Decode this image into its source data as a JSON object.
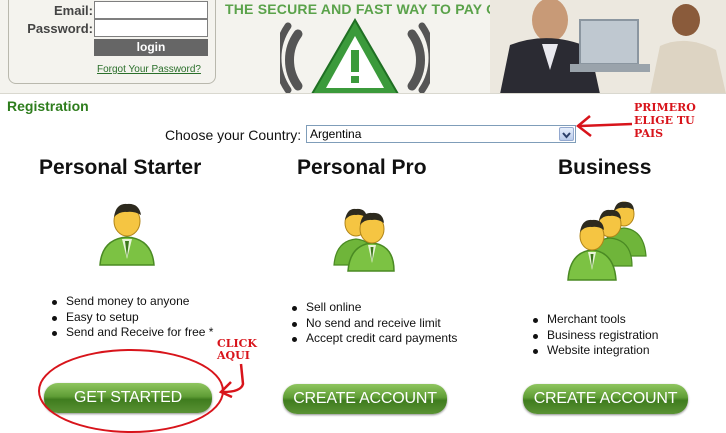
{
  "header": {
    "login": {
      "email_label": "Email:",
      "password_label": "Password:",
      "login_button": "login",
      "forgot_link": "Forgot Your Password?"
    },
    "slogan": "THE SECURE AND FAST WAY TO PAY ONLINE"
  },
  "registration": {
    "heading": "Registration",
    "country_label": "Choose your Country:",
    "country_value": "Argentina"
  },
  "annotations": {
    "primero_line1": "PRIMERO",
    "primero_line2": "ELIGE TU PAIS",
    "click_line1": "CLICK",
    "click_line2": "AQUI",
    "color": "#d8141b"
  },
  "plans": [
    {
      "title": "Personal Starter",
      "icon": "single-user-icon",
      "features": [
        "Send money to anyone",
        "Easy to setup",
        "Send and Receive for free *"
      ],
      "button": "GET STARTED"
    },
    {
      "title": "Personal Pro",
      "icon": "two-users-icon",
      "features": [
        "Sell online",
        "No send and receive limit",
        "Accept credit card payments"
      ],
      "button": "CREATE ACCOUNT"
    },
    {
      "title": "Business",
      "icon": "group-users-icon",
      "features": [
        "Merchant tools",
        "Business registration",
        "Website integration"
      ],
      "button": "CREATE ACCOUNT"
    }
  ],
  "colors": {
    "brand_green": "#5aa24a",
    "heading_green": "#2e7d1d",
    "button_green": "#5f9d36"
  }
}
